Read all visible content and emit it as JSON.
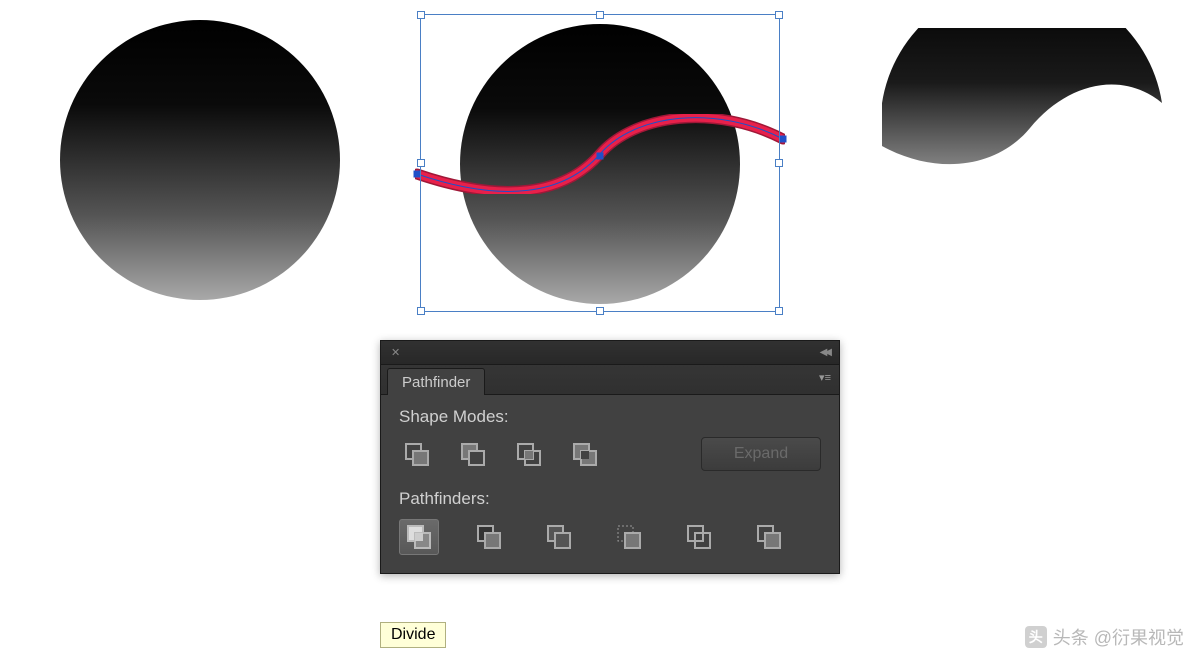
{
  "panel": {
    "title_tab": "Pathfinder",
    "section_shape_modes": "Shape Modes:",
    "section_pathfinders": "Pathfinders:",
    "expand_label": "Expand",
    "shape_modes": [
      {
        "name": "unite"
      },
      {
        "name": "minus-front"
      },
      {
        "name": "intersect"
      },
      {
        "name": "exclude"
      }
    ],
    "pathfinders": [
      {
        "name": "divide",
        "selected": true
      },
      {
        "name": "trim"
      },
      {
        "name": "merge"
      },
      {
        "name": "crop"
      },
      {
        "name": "outline"
      },
      {
        "name": "minus-back"
      }
    ]
  },
  "tooltip": "Divide",
  "watermark": "头条 @衍果视觉",
  "colors": {
    "panel_bg": "#414141",
    "selection_stroke": "#4a7fc5",
    "wave_color": "#d12050",
    "wave_highlight": "#ff3060"
  }
}
